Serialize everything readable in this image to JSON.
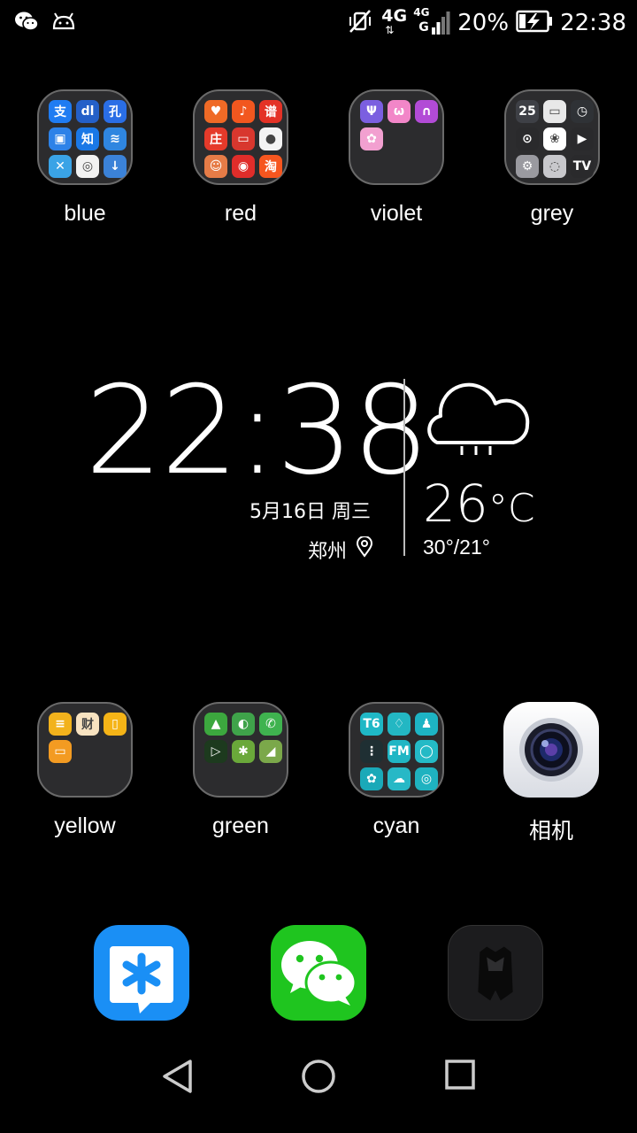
{
  "status_bar": {
    "network_primary": "4G",
    "network_secondary_top": "4G",
    "network_secondary_bottom": "G",
    "battery": "20%",
    "time": "22:38",
    "icons": [
      "wechat-notification-icon",
      "android-icon",
      "vibrate-off-icon",
      "signal-icon",
      "battery-charging-icon"
    ]
  },
  "folders_top": [
    {
      "label": "blue",
      "apps": [
        {
          "glyph": "支",
          "color": "#1f7cf2"
        },
        {
          "glyph": "dl",
          "color": "#2460c8"
        },
        {
          "glyph": "孔",
          "color": "#2a6ee6"
        },
        {
          "glyph": "▣",
          "color": "#2d82e8"
        },
        {
          "glyph": "知",
          "color": "#1a78e6"
        },
        {
          "glyph": "≋",
          "color": "#2f86e0"
        },
        {
          "glyph": "✕",
          "color": "#3aa3e6"
        },
        {
          "glyph": "◎",
          "color": "#f2f2f2"
        },
        {
          "glyph": "↓",
          "color": "#3b82d8"
        }
      ]
    },
    {
      "label": "red",
      "apps": [
        {
          "glyph": "♥",
          "color": "#ef6a26"
        },
        {
          "glyph": "♪",
          "color": "#f2571f"
        },
        {
          "glyph": "谱",
          "color": "#e43226"
        },
        {
          "glyph": "庄",
          "color": "#e53a2a"
        },
        {
          "glyph": "▭",
          "color": "#d8372e"
        },
        {
          "glyph": "●",
          "color": "#f4f4f4"
        },
        {
          "glyph": "☺",
          "color": "#e67c47"
        },
        {
          "glyph": "◉",
          "color": "#e02d2a"
        },
        {
          "glyph": "淘",
          "color": "#f6561f"
        }
      ]
    },
    {
      "label": "violet",
      "apps": [
        {
          "glyph": "Ψ",
          "color": "#7b5fe0"
        },
        {
          "glyph": "ω",
          "color": "#f286c8"
        },
        {
          "glyph": "∩",
          "color": "#b24bd6"
        },
        {
          "glyph": "✿",
          "color": "#f2a0d0"
        }
      ]
    },
    {
      "label": "grey",
      "apps": [
        {
          "glyph": "25",
          "color": "#3e4046"
        },
        {
          "glyph": "▭",
          "color": "#e8e8e8"
        },
        {
          "glyph": "◷",
          "color": "#2f3236"
        },
        {
          "glyph": "⊙",
          "color": "#2a2a2c"
        },
        {
          "glyph": "❀",
          "color": "#ffffff"
        },
        {
          "glyph": "▶",
          "color": "#2a2a2c"
        },
        {
          "glyph": "⚙",
          "color": "#9a9aa0"
        },
        {
          "glyph": "◌",
          "color": "#c8c8cc"
        },
        {
          "glyph": "TV",
          "color": "#2a2a2c"
        }
      ]
    }
  ],
  "clock_widget": {
    "hours": "22",
    "minutes": "38",
    "colon": ":",
    "date": "5月16日  周三",
    "city": "郑州",
    "temperature": "26",
    "temp_unit": "°C",
    "temp_range": "30°/21°"
  },
  "folders_bottom": [
    {
      "label": "yellow",
      "apps": [
        {
          "glyph": "≡",
          "color": "#f2b21c"
        },
        {
          "glyph": "财",
          "color": "#f7e2c0"
        },
        {
          "glyph": "▯",
          "color": "#f5b417"
        },
        {
          "glyph": "▭",
          "color": "#f39b22"
        }
      ]
    },
    {
      "label": "green",
      "apps": [
        {
          "glyph": "▲",
          "color": "#3ca73e"
        },
        {
          "glyph": "◐",
          "color": "#3fa34a"
        },
        {
          "glyph": "✆",
          "color": "#3fb34f"
        },
        {
          "glyph": "▷",
          "color": "#1d3a1e"
        },
        {
          "glyph": "✱",
          "color": "#6aa83a"
        },
        {
          "glyph": "◢",
          "color": "#7ba84a"
        }
      ]
    },
    {
      "label": "cyan",
      "apps": [
        {
          "glyph": "T6",
          "color": "#1fb8c6"
        },
        {
          "glyph": "♢",
          "color": "#23b7c3"
        },
        {
          "glyph": "♟",
          "color": "#1db4c4"
        },
        {
          "glyph": "⋮",
          "color": "#1f2f33"
        },
        {
          "glyph": "FM",
          "color": "#20b6c4"
        },
        {
          "glyph": "◯",
          "color": "#24bac6"
        },
        {
          "glyph": "✿",
          "color": "#1aa9b8"
        },
        {
          "glyph": "☁",
          "color": "#27b8c6"
        },
        {
          "glyph": "◎",
          "color": "#1fb2c0"
        }
      ]
    }
  ],
  "camera_app": {
    "label": "相机"
  },
  "dock": [
    {
      "name": "tim-icon",
      "color": "#1a8ff5"
    },
    {
      "name": "wechat-icon",
      "color": "#1fc51f"
    },
    {
      "name": "batman-icon",
      "color": "#1c1c1e"
    }
  ],
  "nav_bar": {
    "icons": [
      "back-icon",
      "home-icon",
      "recents-icon"
    ]
  }
}
